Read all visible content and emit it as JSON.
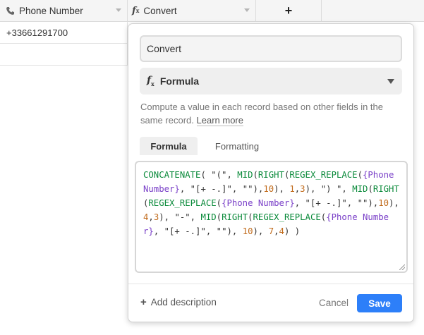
{
  "columns": {
    "phone": {
      "label": "Phone Number",
      "icon": "phone-icon"
    },
    "convert": {
      "label": "Convert",
      "icon": "formula-fx-icon"
    },
    "add": {
      "label": "+"
    }
  },
  "rows": [
    {
      "phone": "+33661291700"
    },
    {
      "phone": ""
    }
  ],
  "popup": {
    "field_name": "Convert",
    "field_type": "Formula",
    "description": "Compute a value in each record based on other fields in the same record.",
    "learn_more": "Learn more",
    "tabs": [
      "Formula",
      "Formatting"
    ],
    "active_tab": "Formula",
    "formula": "CONCATENATE( \"(\", MID(RIGHT(REGEX_REPLACE({Phone Number}, \"[+ -.]\", \"\"),10), 1,3), \") \", MID(RIGHT(REGEX_REPLACE({Phone Number}, \"[+ -.]\", \"\"),10), 4,3), \"-\", MID(RIGHT(REGEX_REPLACE({Phone Number}, \"[+ -.]\", \"\"), 10), 7,4) )",
    "add_description": "Add description",
    "cancel": "Cancel",
    "save": "Save"
  },
  "colors": {
    "accent": "#2d7ff9",
    "function_token": "#0a8a3a",
    "field_token": "#7a40c8",
    "number_token": "#c06a1a"
  }
}
